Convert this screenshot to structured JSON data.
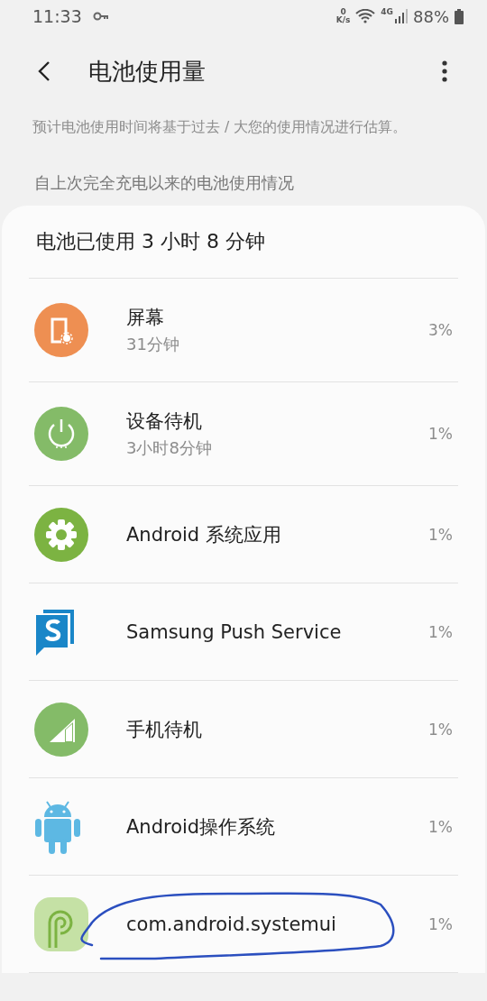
{
  "status_bar": {
    "time": "11:33",
    "speed_value": "0",
    "speed_unit": "K/s",
    "network": "4G",
    "battery": "88%"
  },
  "header": {
    "title": "电池使用量"
  },
  "note": "预计电池使用时间将基于过去 / 大您的使用情况进行估算。",
  "section_title": "自上次完全充电以来的电池使用情况",
  "card": {
    "summary": "电池已使用 3 小时 8 分钟",
    "items": [
      {
        "kind": "screen",
        "name": "屏幕",
        "detail": "31分钟",
        "percent": "3%"
      },
      {
        "kind": "standby",
        "name": "设备待机",
        "detail": "3小时8分钟",
        "percent": "1%"
      },
      {
        "kind": "gear",
        "name": "Android 系统应用",
        "percent": "1%"
      },
      {
        "kind": "push",
        "name": "Samsung Push Service",
        "percent": "1%"
      },
      {
        "kind": "signal",
        "name": "手机待机",
        "percent": "1%"
      },
      {
        "kind": "android",
        "name": "Android操作系统",
        "percent": "1%"
      },
      {
        "kind": "pie",
        "name": "com.android.systemui",
        "percent": "1%",
        "circled": true
      }
    ]
  }
}
